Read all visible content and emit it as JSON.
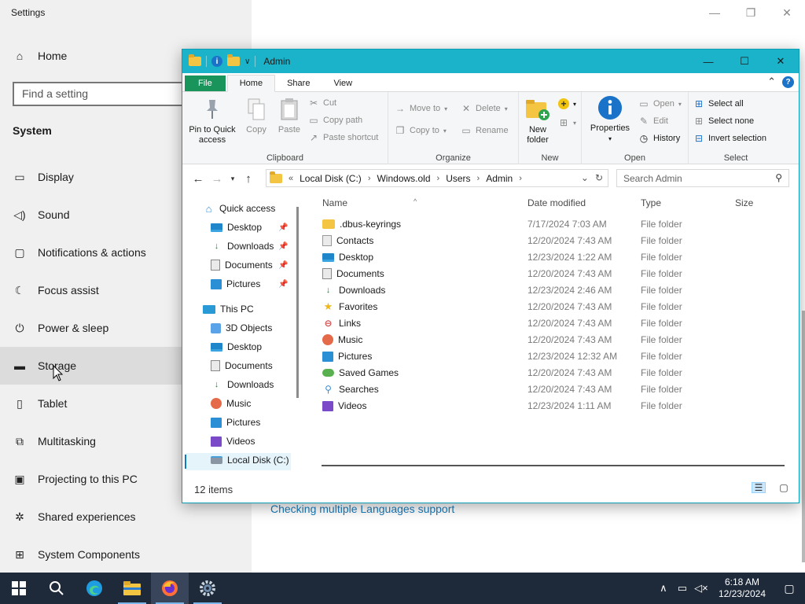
{
  "settings": {
    "title": "Settings",
    "home_label": "Home",
    "search_placeholder": "Find a setting",
    "section_heading": "System",
    "nav_items": [
      {
        "label": "Display",
        "icon": "monitor-icon"
      },
      {
        "label": "Sound",
        "icon": "speaker-icon"
      },
      {
        "label": "Notifications & actions",
        "icon": "notification-icon"
      },
      {
        "label": "Focus assist",
        "icon": "moon-icon"
      },
      {
        "label": "Power & sleep",
        "icon": "power-icon"
      },
      {
        "label": "Storage",
        "icon": "storage-icon"
      },
      {
        "label": "Tablet",
        "icon": "tablet-icon"
      },
      {
        "label": "Multitasking",
        "icon": "multitasking-icon"
      },
      {
        "label": "Projecting to this PC",
        "icon": "projector-icon"
      },
      {
        "label": "Shared experiences",
        "icon": "shared-icon"
      },
      {
        "label": "System Components",
        "icon": "components-icon"
      }
    ],
    "active_nav": "Storage",
    "content_link": "Checking multiple Languages support"
  },
  "explorer": {
    "title": "Admin",
    "tabs": [
      "File",
      "Home",
      "Share",
      "View"
    ],
    "active_tab": "Home",
    "ribbon": {
      "clipboard": {
        "pin_label": "Pin to Quick access",
        "copy_label": "Copy",
        "paste_label": "Paste",
        "cut_label": "Cut",
        "copy_path_label": "Copy path",
        "paste_shortcut_label": "Paste shortcut",
        "group_label": "Clipboard"
      },
      "organize": {
        "move_to_label": "Move to",
        "copy_to_label": "Copy to",
        "delete_label": "Delete",
        "rename_label": "Rename",
        "group_label": "Organize"
      },
      "new": {
        "new_folder_label": "New folder",
        "group_label": "New"
      },
      "open": {
        "properties_label": "Properties",
        "open_label": "Open",
        "edit_label": "Edit",
        "history_label": "History",
        "group_label": "Open"
      },
      "select": {
        "select_all_label": "Select all",
        "select_none_label": "Select none",
        "invert_label": "Invert selection",
        "group_label": "Select"
      }
    },
    "address": {
      "prefix": "«",
      "segments": [
        "Local Disk (C:)",
        "Windows.old",
        "Users",
        "Admin"
      ]
    },
    "search_placeholder": "Search Admin",
    "nav_pane": {
      "quick_access": "Quick access",
      "quick_items": [
        {
          "label": "Desktop",
          "icon": "desktop-icon"
        },
        {
          "label": "Downloads",
          "icon": "downloads-icon"
        },
        {
          "label": "Documents",
          "icon": "documents-icon"
        },
        {
          "label": "Pictures",
          "icon": "pictures-icon"
        }
      ],
      "this_pc": "This PC",
      "pc_items": [
        {
          "label": "3D Objects",
          "icon": "3d-objects-icon"
        },
        {
          "label": "Desktop",
          "icon": "desktop-icon"
        },
        {
          "label": "Documents",
          "icon": "documents-icon"
        },
        {
          "label": "Downloads",
          "icon": "downloads-icon"
        },
        {
          "label": "Music",
          "icon": "music-icon"
        },
        {
          "label": "Pictures",
          "icon": "pictures-icon"
        },
        {
          "label": "Videos",
          "icon": "videos-icon"
        },
        {
          "label": "Local Disk (C:)",
          "icon": "disk-icon"
        }
      ]
    },
    "columns": {
      "name": "Name",
      "date": "Date modified",
      "type": "Type",
      "size": "Size"
    },
    "files": [
      {
        "name": ".dbus-keyrings",
        "date": "7/17/2024 7:03 AM",
        "type": "File folder",
        "icon": "folder-icon"
      },
      {
        "name": "Contacts",
        "date": "12/20/2024 7:43 AM",
        "type": "File folder",
        "icon": "contacts-icon"
      },
      {
        "name": "Desktop",
        "date": "12/23/2024 1:22 AM",
        "type": "File folder",
        "icon": "desktop-icon"
      },
      {
        "name": "Documents",
        "date": "12/20/2024 7:43 AM",
        "type": "File folder",
        "icon": "documents-icon"
      },
      {
        "name": "Downloads",
        "date": "12/23/2024 2:46 AM",
        "type": "File folder",
        "icon": "downloads-icon"
      },
      {
        "name": "Favorites",
        "date": "12/20/2024 7:43 AM",
        "type": "File folder",
        "icon": "star-icon"
      },
      {
        "name": "Links",
        "date": "12/20/2024 7:43 AM",
        "type": "File folder",
        "icon": "links-icon"
      },
      {
        "name": "Music",
        "date": "12/20/2024 7:43 AM",
        "type": "File folder",
        "icon": "music-icon"
      },
      {
        "name": "Pictures",
        "date": "12/23/2024 12:32 AM",
        "type": "File folder",
        "icon": "pictures-icon"
      },
      {
        "name": "Saved Games",
        "date": "12/20/2024 7:43 AM",
        "type": "File folder",
        "icon": "saved-games-icon"
      },
      {
        "name": "Searches",
        "date": "12/20/2024 7:43 AM",
        "type": "File folder",
        "icon": "searches-icon"
      },
      {
        "name": "Videos",
        "date": "12/23/2024 1:11 AM",
        "type": "File folder",
        "icon": "videos-icon"
      }
    ],
    "status": "12 items"
  },
  "taskbar": {
    "apps": [
      "start-icon",
      "search-icon",
      "edge-icon",
      "file-explorer-icon",
      "firefox-icon",
      "settings-icon"
    ],
    "time": "6:18 AM",
    "date": "12/23/2024"
  }
}
